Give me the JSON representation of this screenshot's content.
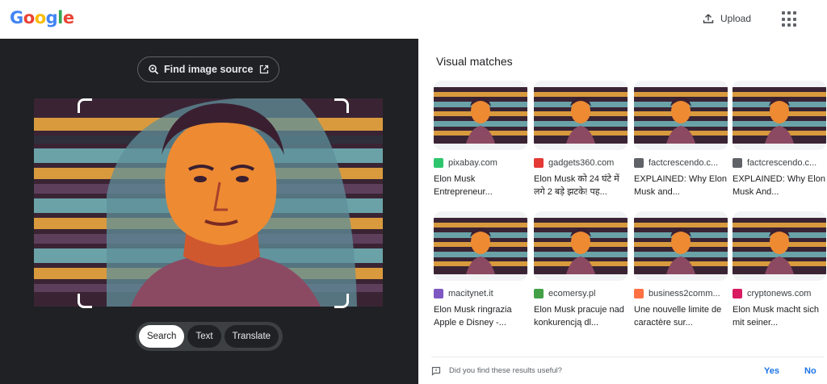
{
  "header": {
    "logo_letters": [
      "G",
      "o",
      "o",
      "g",
      "l",
      "e"
    ],
    "logo_colors": [
      "#4285F4",
      "#EA4335",
      "#FBBC05",
      "#4285F4",
      "#34A853",
      "#EA4335"
    ],
    "upload_label": "Upload"
  },
  "lens": {
    "find_source_label": "Find image source",
    "modes": [
      "Search",
      "Text",
      "Translate"
    ],
    "active_mode": "Search"
  },
  "results": {
    "title": "Visual matches",
    "cards": [
      {
        "source": "pixabay.com",
        "favicon": "px",
        "favicon_color": "#2ec66d",
        "caption": "Elon Musk Entrepreneur..."
      },
      {
        "source": "gadgets360.com",
        "favicon": "360",
        "favicon_color": "#e53935",
        "caption": "Elon Musk को 24 घंटे में लगे 2 बड़े झटके! पह..."
      },
      {
        "source": "factcrescendo.c...",
        "favicon": "magnifier-icon",
        "favicon_color": "#5f6368",
        "caption": "EXPLAINED: Why Elon Musk and..."
      },
      {
        "source": "factcrescendo.c...",
        "favicon": "magnifier-icon",
        "favicon_color": "#5f6368",
        "caption": "EXPLAINED: Why Elon Musk And..."
      },
      {
        "source": "macitynet.it",
        "favicon": "star",
        "favicon_color": "#7e57c2",
        "caption": "Elon Musk ringrazia Apple e Disney -..."
      },
      {
        "source": "ecomersy.pl",
        "favicon": "e",
        "favicon_color": "#43a047",
        "caption": "Elon Musk pracuje nad konkurencją dl..."
      },
      {
        "source": "business2comm...",
        "favicon": "b2c",
        "favicon_color": "#ff7043",
        "caption": "Une nouvelle limite de caractère sur..."
      },
      {
        "source": "cryptonews.com",
        "favicon": "c",
        "favicon_color": "#d81b60",
        "caption": "Elon Musk macht sich mit seiner..."
      }
    ]
  },
  "feedback": {
    "question": "Did you find these results useful?",
    "yes_label": "Yes",
    "no_label": "No"
  }
}
